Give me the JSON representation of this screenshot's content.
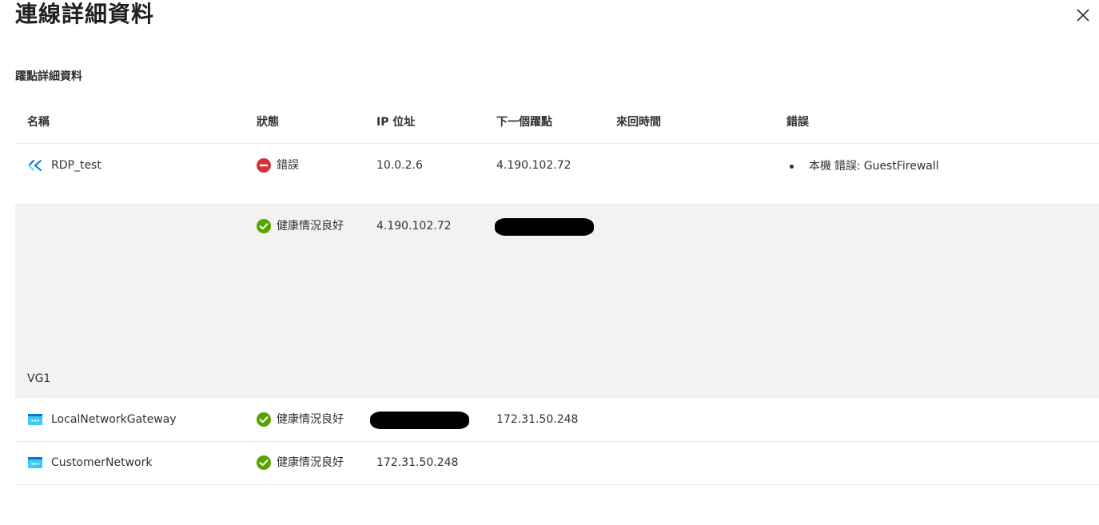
{
  "dialog": {
    "title": "連線詳細資料",
    "close_icon": "close-icon"
  },
  "section": {
    "title": "躍點詳細資料"
  },
  "table": {
    "columns": {
      "name": "名稱",
      "status": "狀態",
      "ip": "IP 位址",
      "next_hop": "下一個躍點",
      "rtt": "來回時間",
      "error": "錯誤"
    },
    "rows": [
      {
        "name": "RDP_test",
        "icon": "vm-connection-icon",
        "status": "錯誤",
        "status_icon": "error-icon",
        "ip": "10.0.2.6",
        "next_hop": "4.190.102.72",
        "rtt": "",
        "error_scope": "本機",
        "error_label": "錯誤:",
        "error_value": "GuestFirewall"
      },
      {
        "name": "VG1",
        "status": "健康情況良好",
        "status_icon": "healthy-check-icon",
        "ip": "4.190.102.72",
        "next_hop": "",
        "rtt": "",
        "error": ""
      },
      {
        "name": "LocalNetworkGateway",
        "icon": "network-gateway-icon",
        "status": "健康情況良好",
        "status_icon": "healthy-check-icon",
        "ip": "",
        "next_hop": "172.31.50.248",
        "rtt": "",
        "error": ""
      },
      {
        "name": "CustomerNetwork",
        "icon": "network-gateway-icon",
        "status": "健康情況良好",
        "status_icon": "healthy-check-icon",
        "ip": "172.31.50.248",
        "next_hop": "",
        "rtt": "",
        "error": ""
      }
    ]
  },
  "colors": {
    "error": "#d13438",
    "healthy": "#57a300",
    "row_highlight": "#f3f2f1",
    "gateway_icon": "#3ccbf4",
    "vm_icon": "#0078d4"
  }
}
